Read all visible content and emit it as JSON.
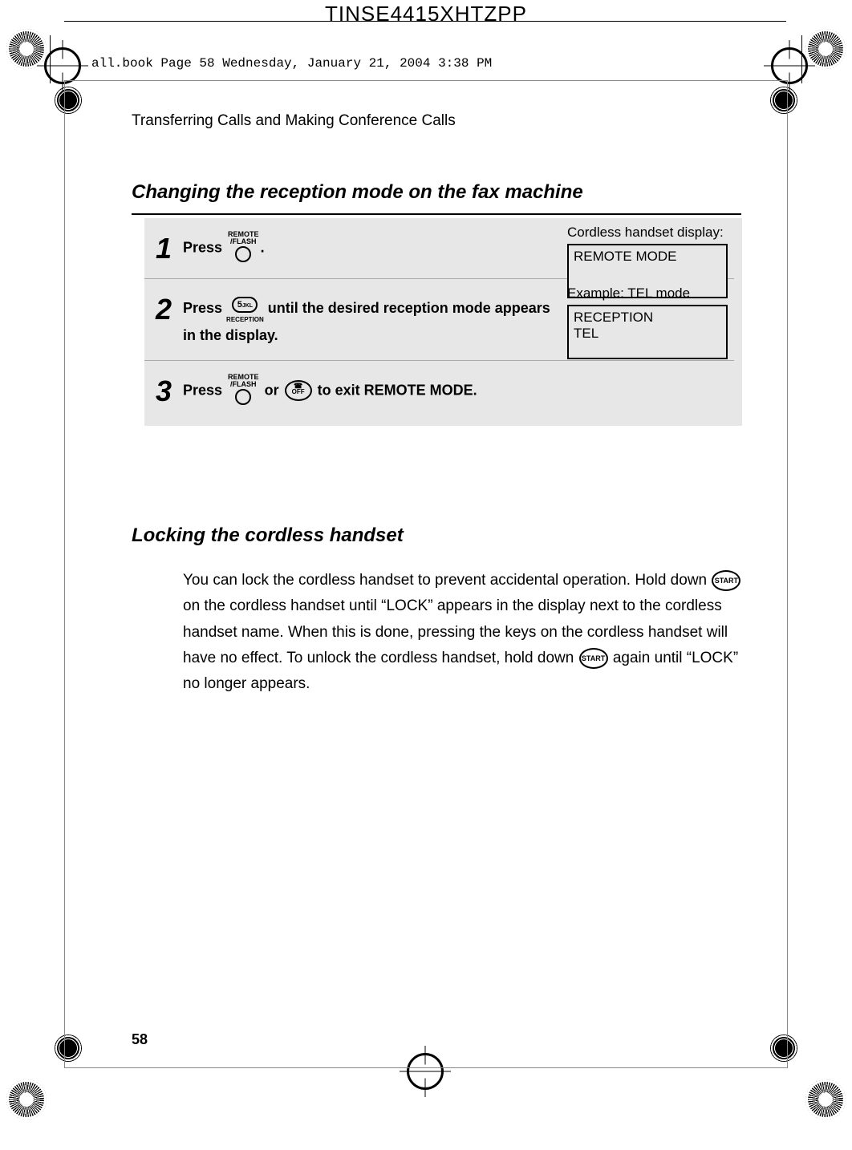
{
  "doc_code": "TINSE4415XHTZPP",
  "book_note": "all.book  Page 58  Wednesday, January 21, 2004  3:38 PM",
  "running_head": "Transferring Calls and Making Conference Calls",
  "section1_title": "Changing the reception mode on the fax machine",
  "section2_title": "Locking the cordless handset",
  "page_number": "58",
  "steps": [
    {
      "num": "1",
      "pre": "Press ",
      "key_top": "REMOTE",
      "key_mid": "/FLASH",
      "post": ".",
      "side_label": "Cordless handset display:",
      "display": "REMOTE MODE"
    },
    {
      "num": "2",
      "pre": "Press ",
      "key_face": "5",
      "key_sup": "JKL",
      "key_sub": "RECEPTION",
      "post": " until the desired reception mode appears in the display.",
      "side_label": "Example: TEL mode",
      "display_l1": "RECEPTION",
      "display_l2": "TEL"
    },
    {
      "num": "3",
      "pre": "Press ",
      "key_top": "REMOTE",
      "key_mid": "/FLASH",
      "mid": " or ",
      "off_label": "OFF",
      "post": " to exit REMOTE MODE."
    }
  ],
  "lock_paragraph": {
    "t1": "You can lock the cordless handset to prevent accidental operation. Hold down ",
    "start1": "START",
    "t2": " on the cordless handset until “LOCK” appears in the display next to the cordless handset name. When this is done, pressing the keys on the cordless handset will have no effect. To unlock the cordless handset, hold down ",
    "start2": "START",
    "t3": " again until “LOCK” no longer appears."
  }
}
